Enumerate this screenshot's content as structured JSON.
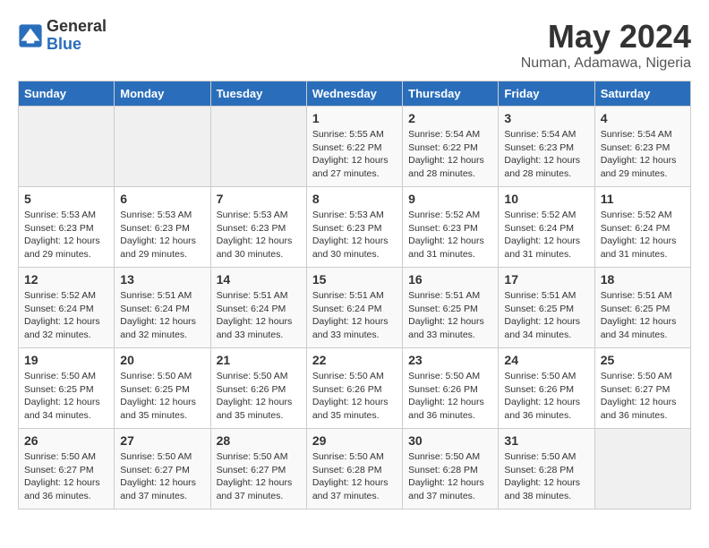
{
  "header": {
    "logo_general": "General",
    "logo_blue": "Blue",
    "month_year": "May 2024",
    "location": "Numan, Adamawa, Nigeria"
  },
  "weekdays": [
    "Sunday",
    "Monday",
    "Tuesday",
    "Wednesday",
    "Thursday",
    "Friday",
    "Saturday"
  ],
  "weeks": [
    [
      {
        "day": "",
        "info": ""
      },
      {
        "day": "",
        "info": ""
      },
      {
        "day": "",
        "info": ""
      },
      {
        "day": "1",
        "info": "Sunrise: 5:55 AM\nSunset: 6:22 PM\nDaylight: 12 hours\nand 27 minutes."
      },
      {
        "day": "2",
        "info": "Sunrise: 5:54 AM\nSunset: 6:22 PM\nDaylight: 12 hours\nand 28 minutes."
      },
      {
        "day": "3",
        "info": "Sunrise: 5:54 AM\nSunset: 6:23 PM\nDaylight: 12 hours\nand 28 minutes."
      },
      {
        "day": "4",
        "info": "Sunrise: 5:54 AM\nSunset: 6:23 PM\nDaylight: 12 hours\nand 29 minutes."
      }
    ],
    [
      {
        "day": "5",
        "info": "Sunrise: 5:53 AM\nSunset: 6:23 PM\nDaylight: 12 hours\nand 29 minutes."
      },
      {
        "day": "6",
        "info": "Sunrise: 5:53 AM\nSunset: 6:23 PM\nDaylight: 12 hours\nand 29 minutes."
      },
      {
        "day": "7",
        "info": "Sunrise: 5:53 AM\nSunset: 6:23 PM\nDaylight: 12 hours\nand 30 minutes."
      },
      {
        "day": "8",
        "info": "Sunrise: 5:53 AM\nSunset: 6:23 PM\nDaylight: 12 hours\nand 30 minutes."
      },
      {
        "day": "9",
        "info": "Sunrise: 5:52 AM\nSunset: 6:23 PM\nDaylight: 12 hours\nand 31 minutes."
      },
      {
        "day": "10",
        "info": "Sunrise: 5:52 AM\nSunset: 6:24 PM\nDaylight: 12 hours\nand 31 minutes."
      },
      {
        "day": "11",
        "info": "Sunrise: 5:52 AM\nSunset: 6:24 PM\nDaylight: 12 hours\nand 31 minutes."
      }
    ],
    [
      {
        "day": "12",
        "info": "Sunrise: 5:52 AM\nSunset: 6:24 PM\nDaylight: 12 hours\nand 32 minutes."
      },
      {
        "day": "13",
        "info": "Sunrise: 5:51 AM\nSunset: 6:24 PM\nDaylight: 12 hours\nand 32 minutes."
      },
      {
        "day": "14",
        "info": "Sunrise: 5:51 AM\nSunset: 6:24 PM\nDaylight: 12 hours\nand 33 minutes."
      },
      {
        "day": "15",
        "info": "Sunrise: 5:51 AM\nSunset: 6:24 PM\nDaylight: 12 hours\nand 33 minutes."
      },
      {
        "day": "16",
        "info": "Sunrise: 5:51 AM\nSunset: 6:25 PM\nDaylight: 12 hours\nand 33 minutes."
      },
      {
        "day": "17",
        "info": "Sunrise: 5:51 AM\nSunset: 6:25 PM\nDaylight: 12 hours\nand 34 minutes."
      },
      {
        "day": "18",
        "info": "Sunrise: 5:51 AM\nSunset: 6:25 PM\nDaylight: 12 hours\nand 34 minutes."
      }
    ],
    [
      {
        "day": "19",
        "info": "Sunrise: 5:50 AM\nSunset: 6:25 PM\nDaylight: 12 hours\nand 34 minutes."
      },
      {
        "day": "20",
        "info": "Sunrise: 5:50 AM\nSunset: 6:25 PM\nDaylight: 12 hours\nand 35 minutes."
      },
      {
        "day": "21",
        "info": "Sunrise: 5:50 AM\nSunset: 6:26 PM\nDaylight: 12 hours\nand 35 minutes."
      },
      {
        "day": "22",
        "info": "Sunrise: 5:50 AM\nSunset: 6:26 PM\nDaylight: 12 hours\nand 35 minutes."
      },
      {
        "day": "23",
        "info": "Sunrise: 5:50 AM\nSunset: 6:26 PM\nDaylight: 12 hours\nand 36 minutes."
      },
      {
        "day": "24",
        "info": "Sunrise: 5:50 AM\nSunset: 6:26 PM\nDaylight: 12 hours\nand 36 minutes."
      },
      {
        "day": "25",
        "info": "Sunrise: 5:50 AM\nSunset: 6:27 PM\nDaylight: 12 hours\nand 36 minutes."
      }
    ],
    [
      {
        "day": "26",
        "info": "Sunrise: 5:50 AM\nSunset: 6:27 PM\nDaylight: 12 hours\nand 36 minutes."
      },
      {
        "day": "27",
        "info": "Sunrise: 5:50 AM\nSunset: 6:27 PM\nDaylight: 12 hours\nand 37 minutes."
      },
      {
        "day": "28",
        "info": "Sunrise: 5:50 AM\nSunset: 6:27 PM\nDaylight: 12 hours\nand 37 minutes."
      },
      {
        "day": "29",
        "info": "Sunrise: 5:50 AM\nSunset: 6:28 PM\nDaylight: 12 hours\nand 37 minutes."
      },
      {
        "day": "30",
        "info": "Sunrise: 5:50 AM\nSunset: 6:28 PM\nDaylight: 12 hours\nand 37 minutes."
      },
      {
        "day": "31",
        "info": "Sunrise: 5:50 AM\nSunset: 6:28 PM\nDaylight: 12 hours\nand 38 minutes."
      },
      {
        "day": "",
        "info": ""
      }
    ]
  ]
}
